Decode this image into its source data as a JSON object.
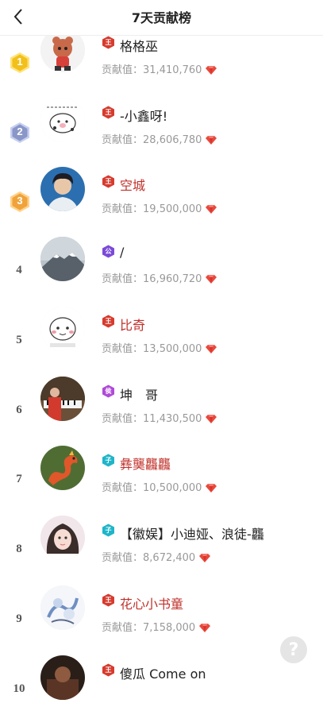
{
  "header": {
    "title": "7天贡献榜"
  },
  "contrib_prefix": "贡献值：",
  "help": {
    "label": "?"
  },
  "colors": {
    "accent_red": "#c0312b",
    "gem": "#e8483c",
    "gold": "#f2c01a",
    "silver": "#8a96c8",
    "bronze": "#f0a33a"
  },
  "rows": [
    {
      "rank": "1",
      "tag": "王",
      "tag_color": "#d63b2e",
      "name": "格格巫",
      "name_red": false,
      "contrib": "31,410,760",
      "avatar": "cartoon-bear"
    },
    {
      "rank": "2",
      "tag": "王",
      "tag_color": "#d63b2e",
      "name": "-小鑫呀!",
      "name_red": false,
      "contrib": "28,606,780",
      "avatar": "cartoon-pig"
    },
    {
      "rank": "3",
      "tag": "王",
      "tag_color": "#d63b2e",
      "name": "空城",
      "name_red": true,
      "contrib": "19,500,000",
      "avatar": "portrait-man"
    },
    {
      "rank": "4",
      "tag": "公",
      "tag_color": "#7b4ad8",
      "name": "/",
      "name_red": false,
      "contrib": "16,960,720",
      "avatar": "mountain"
    },
    {
      "rank": "5",
      "tag": "王",
      "tag_color": "#d63b2e",
      "name": "比奇",
      "name_red": true,
      "contrib": "13,500,000",
      "avatar": "cartoon-face"
    },
    {
      "rank": "6",
      "tag": "侯",
      "tag_color": "#b04ad8",
      "name": "坤　哥",
      "name_red": false,
      "contrib": "11,430,500",
      "avatar": "piano"
    },
    {
      "rank": "7",
      "tag": "子",
      "tag_color": "#1fb5c9",
      "name": "彝龑龘龘",
      "name_red": true,
      "contrib": "10,500,000",
      "avatar": "dragon"
    },
    {
      "rank": "8",
      "tag": "子",
      "tag_color": "#1fb5c9",
      "name": "【徽娱】小迪娅、浪徒-龘",
      "name_red": false,
      "contrib": "8,672,400",
      "avatar": "portrait-girl"
    },
    {
      "rank": "9",
      "tag": "王",
      "tag_color": "#d63b2e",
      "name": "花心小书童",
      "name_red": true,
      "contrib": "7,158,000",
      "avatar": "ink-art"
    },
    {
      "rank": "10",
      "tag": "王",
      "tag_color": "#d63b2e",
      "name": "傻瓜 Come on",
      "name_red": false,
      "contrib": "",
      "avatar": "dark-photo"
    }
  ]
}
